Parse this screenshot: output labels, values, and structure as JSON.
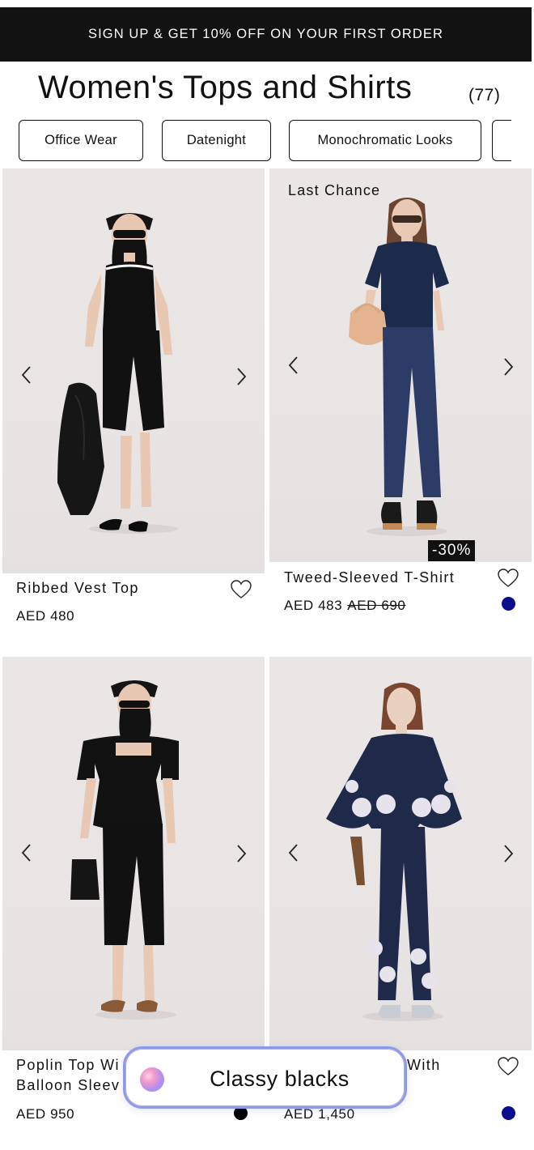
{
  "promo": {
    "text": "SIGN UP & GET 10% OFF ON YOUR FIRST ORDER"
  },
  "header": {
    "title": "Women's Tops and Shirts",
    "count": "(77)"
  },
  "filters": [
    {
      "label": "Office Wear"
    },
    {
      "label": "Datenight"
    },
    {
      "label": "Monochromatic Looks"
    },
    {
      "label": ""
    }
  ],
  "products": [
    {
      "name": "Ribbed Vest Top",
      "name_line2": "",
      "price": "AED 480",
      "old_price": "",
      "tag": "",
      "discount": "",
      "swatch_color": ""
    },
    {
      "name": "Tweed-Sleeved T-Shirt",
      "name_line2": "",
      "price": "AED 483",
      "old_price": "AED 690",
      "tag": "Last Chance",
      "discount": "-30%",
      "swatch_color": "#0b0f8f"
    },
    {
      "name": "Poplin Top Wi",
      "name_line2": "Balloon Sleev",
      "price": "AED 950",
      "old_price": "",
      "tag": "",
      "discount": "",
      "swatch_color": "#000000"
    },
    {
      "name": "With",
      "name_line2": "",
      "price": "AED 1,450",
      "old_price": "",
      "tag": "",
      "discount": "",
      "swatch_color": "#0b0f8f"
    }
  ],
  "icons": {
    "prev": "chevron-left-icon",
    "next": "chevron-right-icon",
    "wishlist": "heart-outline-icon",
    "assistant": "gradient-orb-icon"
  },
  "assistant": {
    "label": "Classy blacks"
  },
  "colors": {
    "promo_bg": "#121212",
    "navy_swatch": "#0b0f8f",
    "assistant_border": "#8d9be6"
  }
}
